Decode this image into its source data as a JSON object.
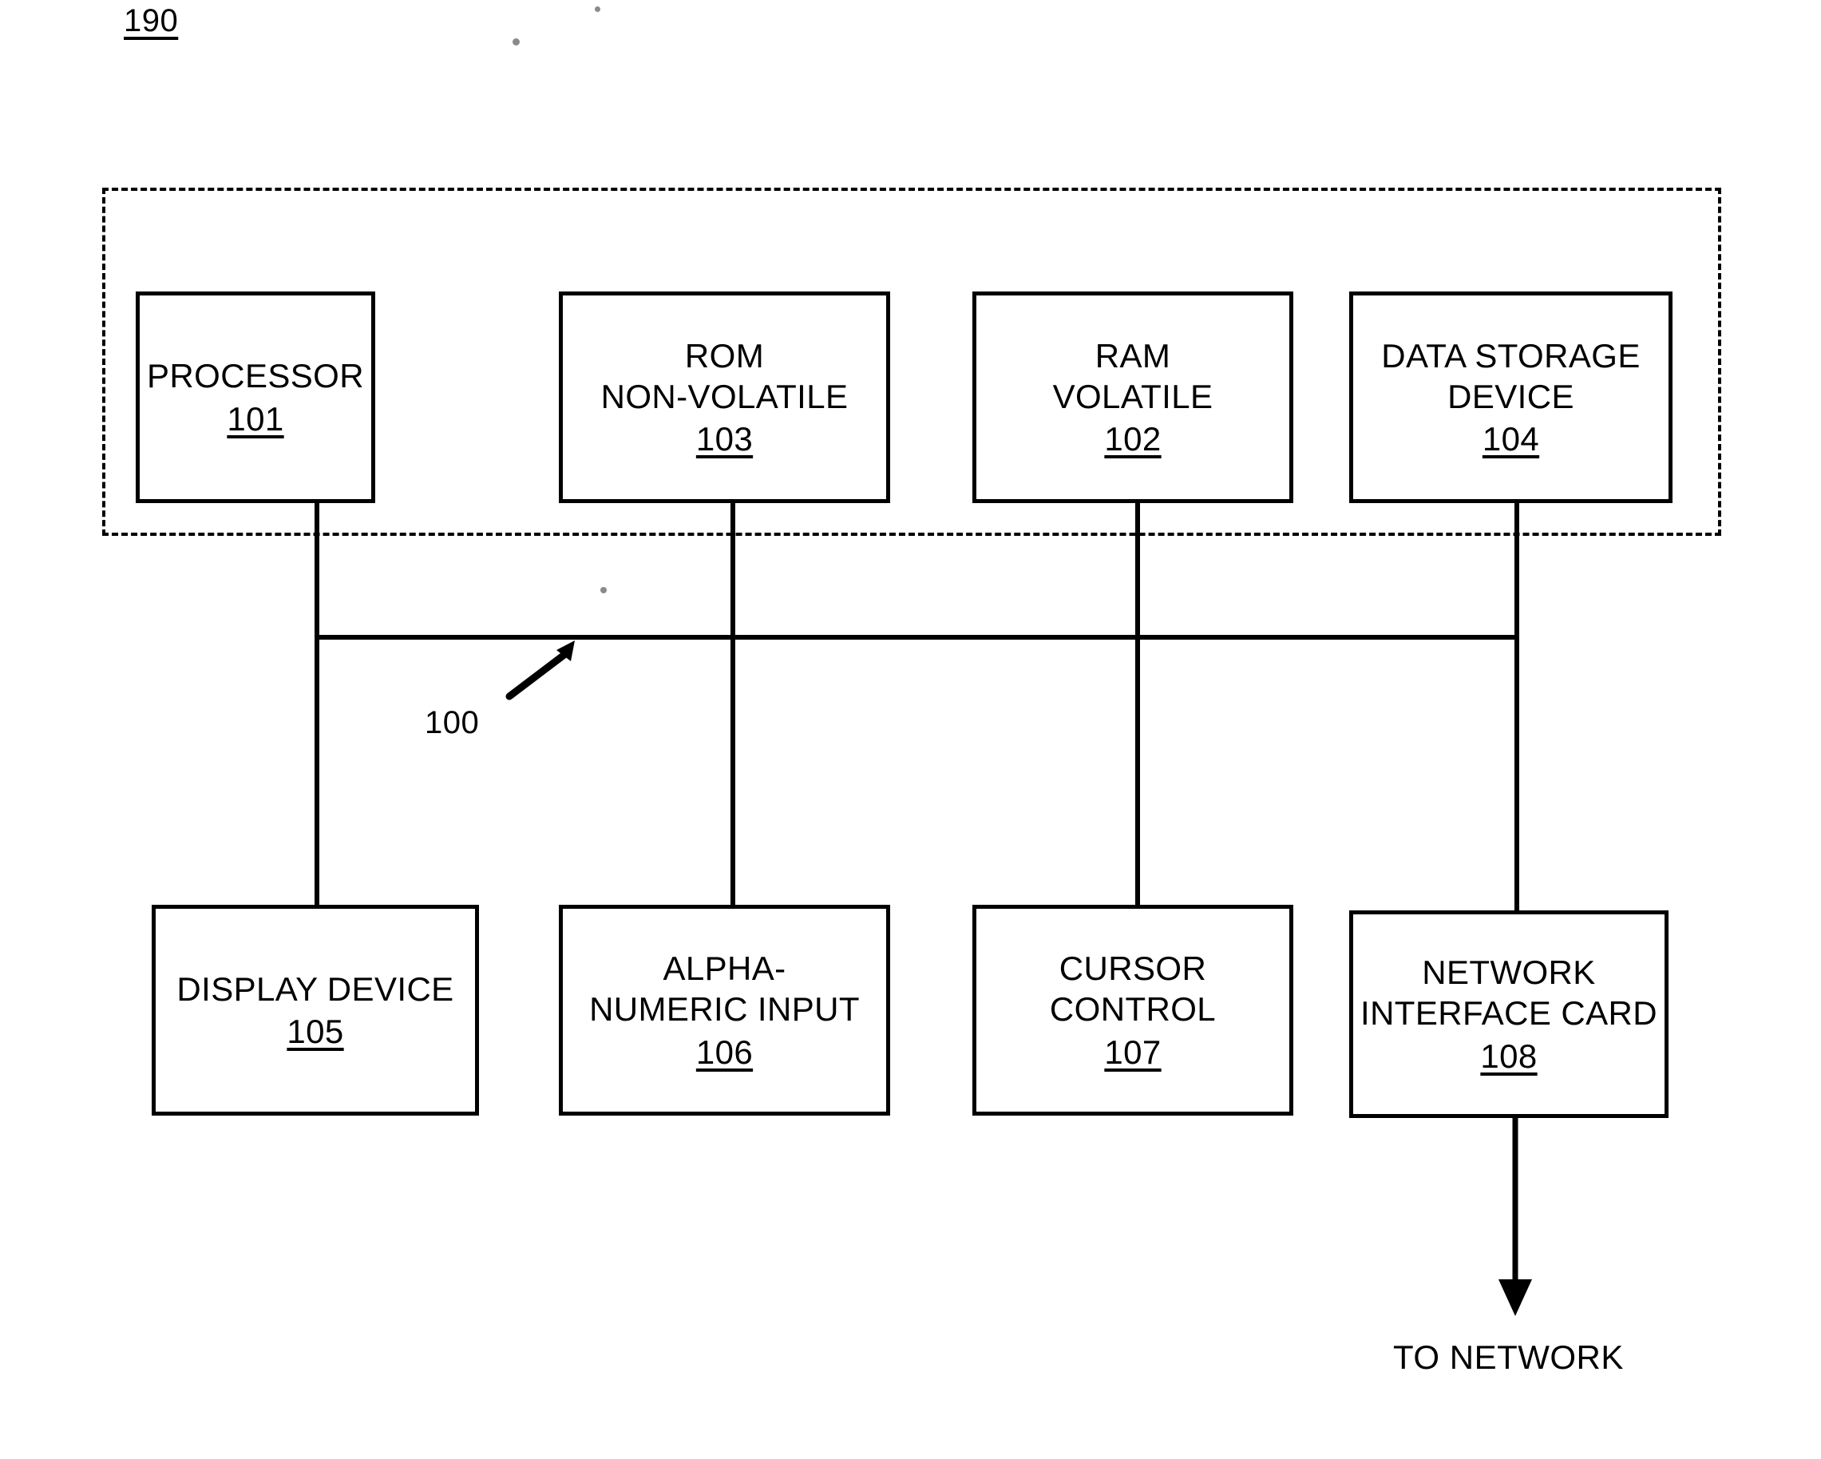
{
  "figure": {
    "reference_number": "190",
    "caption_to_network": "TO NETWORK",
    "bus_callout": "100"
  },
  "top_row": [
    {
      "title": "PROCESSOR",
      "number": "101"
    },
    {
      "title": "ROM\nNON-VOLATILE",
      "number": "103"
    },
    {
      "title": "RAM\nVOLATILE",
      "number": "102"
    },
    {
      "title": "DATA STORAGE\nDEVICE",
      "number": "104"
    }
  ],
  "bottom_row": [
    {
      "title": "DISPLAY DEVICE",
      "number": "105"
    },
    {
      "title": "ALPHA-\nNUMERIC INPUT",
      "number": "106"
    },
    {
      "title": "CURSOR\nCONTROL",
      "number": "107"
    },
    {
      "title": "NETWORK\nINTERFACE CARD",
      "number": "108"
    }
  ],
  "colors": {
    "ink": "#000000",
    "paper": "#ffffff"
  }
}
